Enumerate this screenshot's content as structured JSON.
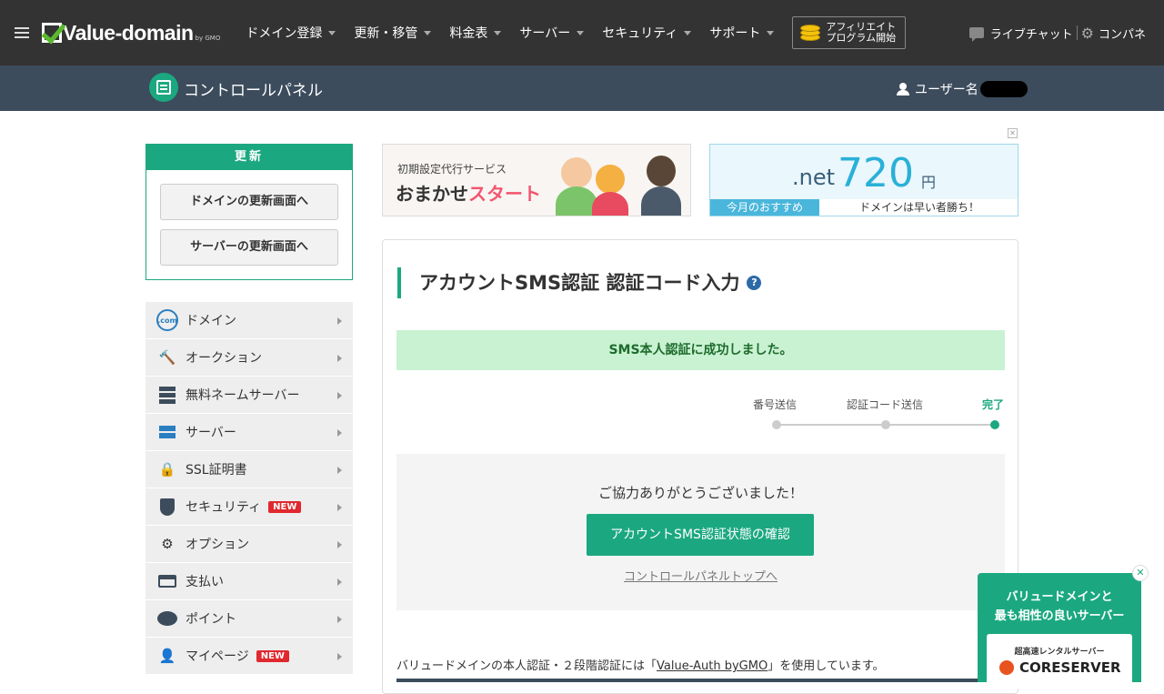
{
  "header": {
    "logo_text": "Value-domain",
    "logo_sub": "by GMO",
    "nav": [
      "ドメイン登録",
      "更新・移管",
      "料金表",
      "サーバー",
      "セキュリティ",
      "サポート"
    ],
    "affiliate_line1": "アフィリエイト",
    "affiliate_line2": "プログラム開始",
    "live_chat": "ライブチャット",
    "control_panel": "コンパネ"
  },
  "subheader": {
    "title": "コントロールパネル",
    "user_label": "ユーザー名"
  },
  "renew": {
    "heading": "更新",
    "domain_button": "ドメインの更新画面へ",
    "server_button": "サーバーの更新画面へ"
  },
  "sidebar": {
    "items": [
      {
        "label": "ドメイン",
        "icon": "globe-icon"
      },
      {
        "label": "オークション",
        "icon": "gavel-icon"
      },
      {
        "label": "無料ネームサーバー",
        "icon": "server-stack-icon"
      },
      {
        "label": "サーバー",
        "icon": "server-icon"
      },
      {
        "label": "SSL証明書",
        "icon": "lock-icon"
      },
      {
        "label": "セキュリティ",
        "icon": "shield-icon",
        "badge": "NEW"
      },
      {
        "label": "オプション",
        "icon": "gears-icon"
      },
      {
        "label": "支払い",
        "icon": "card-icon"
      },
      {
        "label": "ポイント",
        "icon": "piggy-bank-icon"
      },
      {
        "label": "マイページ",
        "icon": "user-icon",
        "badge": "NEW"
      }
    ],
    "dotcom_label": ".com"
  },
  "banners": {
    "left_small": "初期設定代行サービス",
    "left_big_1": "おまかせ",
    "left_big_2": "スタート",
    "right_net": ".net",
    "right_price": "720",
    "right_yen": "円",
    "right_foot_left": "今月のおすすめ",
    "right_foot_right": "ドメインは早い者勝ち！"
  },
  "main": {
    "title": "アカウントSMS認証 認証コード入力",
    "success": "SMS本人認証に成功しました。",
    "steps": [
      {
        "label": "番号送信",
        "active": false
      },
      {
        "label": "認証コード送信",
        "active": false
      },
      {
        "label": "完了",
        "active": true
      }
    ],
    "thanks": "ご協力ありがとうございました！",
    "confirm_button": "アカウントSMS認証状態の確認",
    "top_link": "コントロールパネルトップへ",
    "footer_prefix": "バリュードメインの本人認証・２段階認証には「",
    "footer_link": "Value-Auth byGMO",
    "footer_suffix": "」を使用しています。"
  },
  "float_ad": {
    "line1": "バリュードメインと",
    "line2": "最も相性の良いサーバー",
    "sub": "超高速レンタルサーバー",
    "brand": "CORESERVER"
  },
  "colors": {
    "accent": "#1ba880",
    "topbar": "#333333",
    "subbar": "#3c4c5c",
    "success_bg": "#c9f2d2",
    "new_badge": "#e0282e"
  }
}
